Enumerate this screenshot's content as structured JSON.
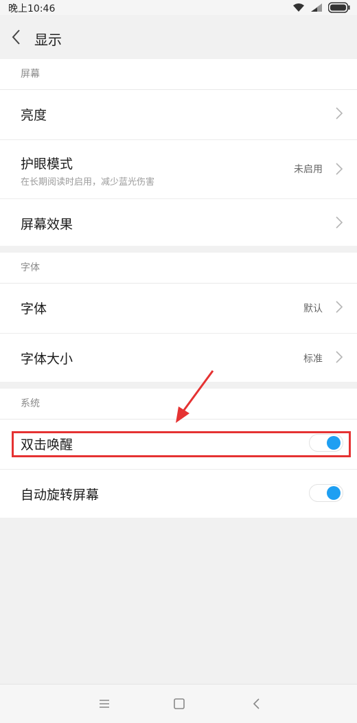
{
  "status_bar": {
    "time": "晚上10:46"
  },
  "header": {
    "title": "显示"
  },
  "sections": [
    {
      "title": "屏幕",
      "items": [
        {
          "label": "亮度"
        },
        {
          "label": "护眼模式",
          "subtitle": "在长期阅读时启用，减少蓝光伤害",
          "value": "未启用"
        },
        {
          "label": "屏幕效果"
        }
      ]
    },
    {
      "title": "字体",
      "items": [
        {
          "label": "字体",
          "value": "默认"
        },
        {
          "label": "字体大小",
          "value": "标准"
        }
      ]
    },
    {
      "title": "系统",
      "items": [
        {
          "label": "双击唤醒",
          "toggle_on": true
        },
        {
          "label": "自动旋转屏幕",
          "toggle_on": true
        }
      ]
    }
  ],
  "colors": {
    "accent": "#1e9ff2",
    "highlight": "#e53232"
  },
  "icons": [
    "wifi-icon",
    "signal-icon",
    "battery-icon",
    "back-arrow-icon",
    "chevron-right-icon",
    "menu-icon",
    "home-icon",
    "back-icon"
  ]
}
